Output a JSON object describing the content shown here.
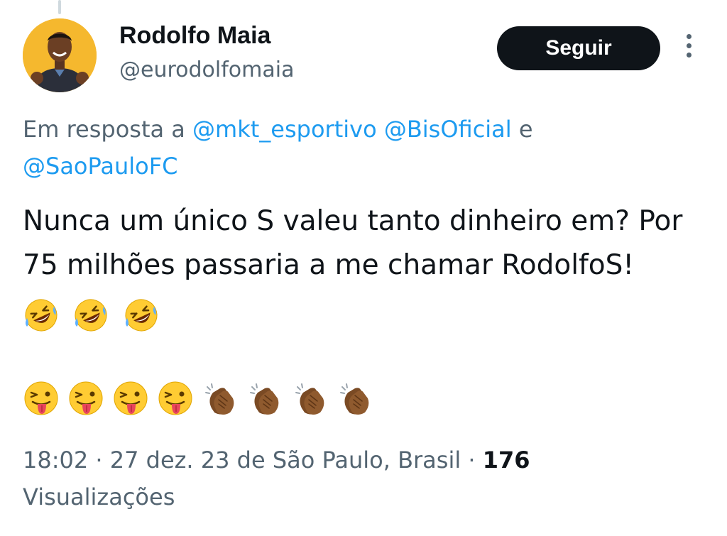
{
  "author": {
    "display_name": "Rodolfo Maia",
    "handle": "@eurodolfomaia",
    "avatar_bg": "#f5b82e"
  },
  "follow_button": {
    "label": "Seguir"
  },
  "more_menu": {
    "icon": "more-vertical-icon"
  },
  "reply_context": {
    "prefix": "Em resposta a",
    "mentions": [
      "@mkt_esportivo",
      "@BisOficial"
    ],
    "conjunction": "e",
    "last_mention": "@SaoPauloFC"
  },
  "tweet": {
    "text": "Nunca um único S valeu tanto dinheiro em? Por 75 milhões passaria a me chamar RodolfoS!",
    "inline_emojis": [
      "rolling-on-floor-laughing",
      "rolling-on-floor-laughing",
      "rolling-on-floor-laughing"
    ],
    "second_line_emojis": [
      "winking-face-with-tongue",
      "winking-face-with-tongue",
      "winking-face-with-tongue",
      "winking-face-with-tongue",
      "clapping-hands",
      "clapping-hands",
      "clapping-hands",
      "clapping-hands"
    ]
  },
  "meta": {
    "time": "18:02",
    "separator": "·",
    "date": "27 dez. 23",
    "location": "de São Paulo, Brasil",
    "views_count": "176",
    "views_label": "Visualizações"
  },
  "colors": {
    "text_primary": "#0f1419",
    "text_secondary": "#536471",
    "link": "#1d9bf0",
    "button_bg": "#0f1419"
  }
}
